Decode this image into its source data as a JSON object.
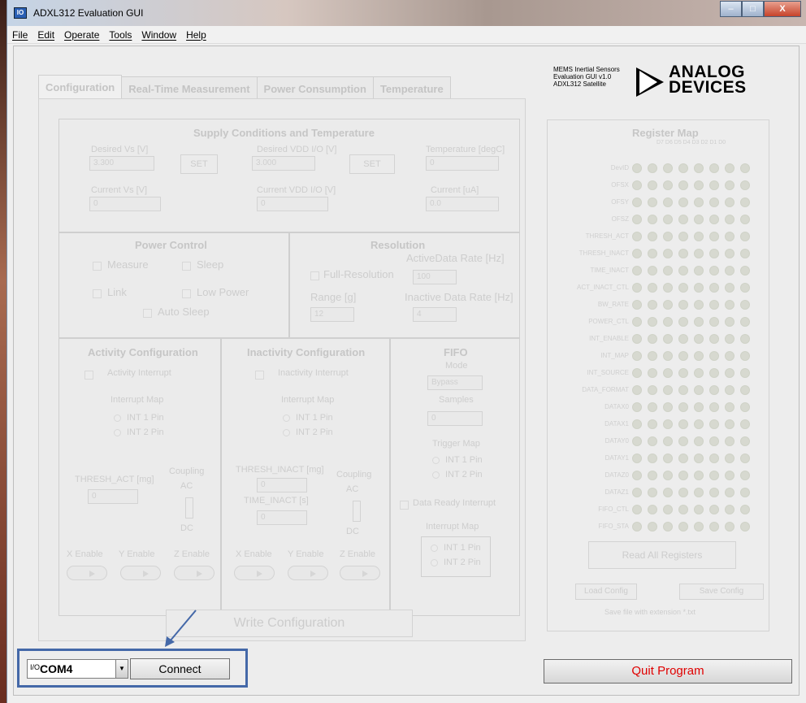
{
  "window": {
    "title": "ADXL312 Evaluation GUI",
    "icon": "app-icon",
    "min_label": "–",
    "max_label": "□",
    "close_label": "X"
  },
  "menu": [
    "File",
    "Edit",
    "Operate",
    "Tools",
    "Window",
    "Help"
  ],
  "tabs": [
    "Configuration",
    "Real-Time Measurement",
    "Power Consumption",
    "Temperature"
  ],
  "logo": {
    "line1": "MEMS Inertial Sensors",
    "line2": "Evaluation GUI v1.0",
    "line3": "ADXL312 Satellite",
    "brand1": "ANALOG",
    "brand2": "DEVICES"
  },
  "supply": {
    "title": "Supply Conditions and Temperature",
    "desired_vs_label": "Desired Vs [V]",
    "desired_vs": "3.300",
    "set": "SET",
    "desired_vddio_label": "Desired VDD I/O [V]",
    "desired_vddio": "3.000",
    "temp_label": "Temperature [degC]",
    "temp": "0",
    "current_vs_label": "Current Vs [V]",
    "current_vs": "0",
    "current_vddio_label": "Current VDD I/O [V]",
    "current_vddio": "0",
    "current_label": "Current [uA]",
    "current": "0.0"
  },
  "power": {
    "title": "Power Control",
    "measure": "Measure",
    "sleep": "Sleep",
    "link": "Link",
    "low_power": "Low Power",
    "auto_sleep": "Auto Sleep"
  },
  "resolution": {
    "title": "Resolution",
    "full_res": "Full-Resolution",
    "active_rate_label": "ActiveData Rate [Hz]",
    "active_rate": "100",
    "range_label": "Range [g]",
    "range": "12",
    "inactive_rate_label": "Inactive Data Rate [Hz]",
    "inactive_rate": "4"
  },
  "activity": {
    "title": "Activity Configuration",
    "interrupt": "Activity Interrupt",
    "map": "Interrupt Map",
    "int1": "INT 1 Pin",
    "int2": "INT 2 Pin",
    "coupling": "Coupling",
    "ac": "AC",
    "dc": "DC",
    "thresh_label": "THRESH_ACT [mg]",
    "thresh": "0",
    "x": "X Enable",
    "y": "Y Enable",
    "z": "Z Enable"
  },
  "inactivity": {
    "title": "Inactivity Configuration",
    "interrupt": "Inactivity Interrupt",
    "map": "Interrupt Map",
    "int1": "INT 1 Pin",
    "int2": "INT 2 Pin",
    "coupling": "Coupling",
    "ac": "AC",
    "dc": "DC",
    "thresh_label": "THRESH_INACT [mg]",
    "thresh": "0",
    "time_label": "TIME_INACT [s]",
    "time": "0",
    "x": "X Enable",
    "y": "Y Enable",
    "z": "Z Enable"
  },
  "fifo": {
    "title": "FIFO",
    "mode_label": "Mode",
    "mode": "Bypass",
    "samples_label": "Samples",
    "samples": "0",
    "trigger": "Trigger Map",
    "int1": "INT 1 Pin",
    "int2": "INT 2 Pin",
    "ready": "Data Ready Interrupt",
    "map": "Interrupt Map",
    "map_int1": "INT 1 Pin",
    "map_int2": "INT 2 Pin"
  },
  "write": "Write Configuration",
  "register_map": {
    "title": "Register Map",
    "bits": "D7 D6 D5 D4 D3 D2 D1 D0",
    "registers": [
      "DevID",
      "OFSX",
      "OFSY",
      "OFSZ",
      "THRESH_ACT",
      "THRESH_INACT",
      "TIME_INACT",
      "ACT_INACT_CTL",
      "BW_RATE",
      "POWER_CTL",
      "INT_ENABLE",
      "INT_MAP",
      "INT_SOURCE",
      "DATA_FORMAT",
      "DATAX0",
      "DATAX1",
      "DATAY0",
      "DATAY1",
      "DATAZ0",
      "DATAZ1",
      "FIFO_CTL",
      "FIFO_STA"
    ],
    "read_all": "Read All Registers",
    "load": "Load Config",
    "save": "Save Config",
    "note": "Save file with extension *.txt"
  },
  "bottom": {
    "io": "I/O",
    "port": "COM4",
    "connect": "Connect",
    "quit": "Quit Program"
  }
}
